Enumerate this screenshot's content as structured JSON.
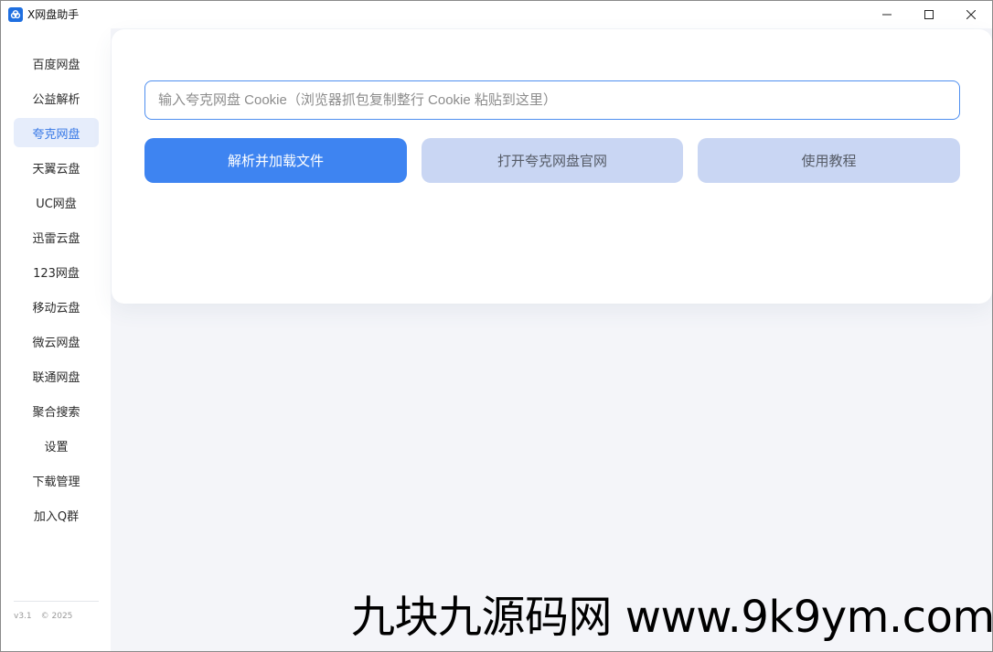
{
  "window": {
    "title": "X网盘助手",
    "controls": [
      "minimize-icon",
      "maximize-icon",
      "close-icon"
    ]
  },
  "sidebar": {
    "items": [
      {
        "label": "百度网盘",
        "active": false
      },
      {
        "label": "公益解析",
        "active": false
      },
      {
        "label": "夸克网盘",
        "active": true
      },
      {
        "label": "天翼云盘",
        "active": false
      },
      {
        "label": "UC网盘",
        "active": false
      },
      {
        "label": "迅雷云盘",
        "active": false
      },
      {
        "label": "123网盘",
        "active": false
      },
      {
        "label": "移动云盘",
        "active": false
      },
      {
        "label": "微云网盘",
        "active": false
      },
      {
        "label": "联通网盘",
        "active": false
      },
      {
        "label": "聚合搜索",
        "active": false
      },
      {
        "label": "设置",
        "active": false
      },
      {
        "label": "下载管理",
        "active": false
      },
      {
        "label": "加入Q群",
        "active": false
      }
    ],
    "version": "v3.1",
    "copyright": "© 2025"
  },
  "main": {
    "cookie_input": {
      "value": "",
      "placeholder": "输入夸克网盘 Cookie（浏览器抓包复制整行 Cookie 粘贴到这里）"
    },
    "buttons": {
      "parse": "解析并加载文件",
      "open_site": "打开夸克网盘官网",
      "tutorial": "使用教程"
    }
  },
  "watermark": "九块九源码网 www.9k9ym.com",
  "colors": {
    "accent": "#3e84f1",
    "secondary_button": "#c9d6f3",
    "active_nav_bg": "#e6edfb",
    "active_nav_text": "#3577e6",
    "content_bg": "#f4f5f9"
  }
}
